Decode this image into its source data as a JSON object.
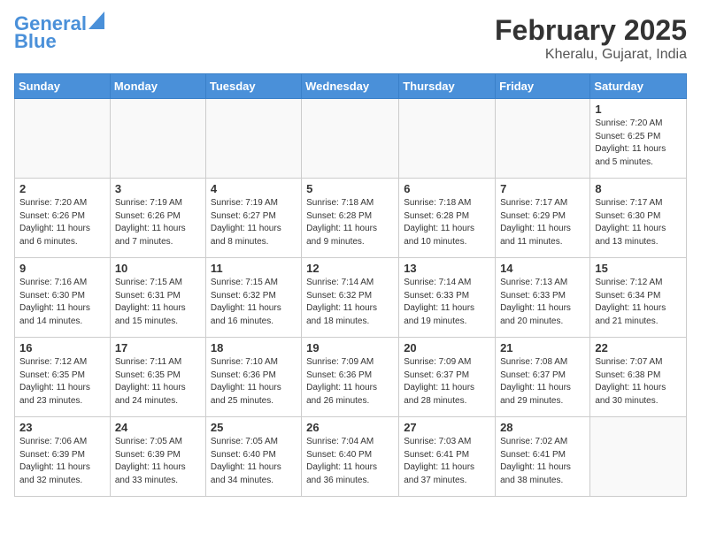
{
  "header": {
    "logo_general": "General",
    "logo_blue": "Blue",
    "month_year": "February 2025",
    "location": "Kheralu, Gujarat, India"
  },
  "days_of_week": [
    "Sunday",
    "Monday",
    "Tuesday",
    "Wednesday",
    "Thursday",
    "Friday",
    "Saturday"
  ],
  "weeks": [
    [
      {
        "day": "",
        "info": ""
      },
      {
        "day": "",
        "info": ""
      },
      {
        "day": "",
        "info": ""
      },
      {
        "day": "",
        "info": ""
      },
      {
        "day": "",
        "info": ""
      },
      {
        "day": "",
        "info": ""
      },
      {
        "day": "1",
        "info": "Sunrise: 7:20 AM\nSunset: 6:25 PM\nDaylight: 11 hours\nand 5 minutes."
      }
    ],
    [
      {
        "day": "2",
        "info": "Sunrise: 7:20 AM\nSunset: 6:26 PM\nDaylight: 11 hours\nand 6 minutes."
      },
      {
        "day": "3",
        "info": "Sunrise: 7:19 AM\nSunset: 6:26 PM\nDaylight: 11 hours\nand 7 minutes."
      },
      {
        "day": "4",
        "info": "Sunrise: 7:19 AM\nSunset: 6:27 PM\nDaylight: 11 hours\nand 8 minutes."
      },
      {
        "day": "5",
        "info": "Sunrise: 7:18 AM\nSunset: 6:28 PM\nDaylight: 11 hours\nand 9 minutes."
      },
      {
        "day": "6",
        "info": "Sunrise: 7:18 AM\nSunset: 6:28 PM\nDaylight: 11 hours\nand 10 minutes."
      },
      {
        "day": "7",
        "info": "Sunrise: 7:17 AM\nSunset: 6:29 PM\nDaylight: 11 hours\nand 11 minutes."
      },
      {
        "day": "8",
        "info": "Sunrise: 7:17 AM\nSunset: 6:30 PM\nDaylight: 11 hours\nand 13 minutes."
      }
    ],
    [
      {
        "day": "9",
        "info": "Sunrise: 7:16 AM\nSunset: 6:30 PM\nDaylight: 11 hours\nand 14 minutes."
      },
      {
        "day": "10",
        "info": "Sunrise: 7:15 AM\nSunset: 6:31 PM\nDaylight: 11 hours\nand 15 minutes."
      },
      {
        "day": "11",
        "info": "Sunrise: 7:15 AM\nSunset: 6:32 PM\nDaylight: 11 hours\nand 16 minutes."
      },
      {
        "day": "12",
        "info": "Sunrise: 7:14 AM\nSunset: 6:32 PM\nDaylight: 11 hours\nand 18 minutes."
      },
      {
        "day": "13",
        "info": "Sunrise: 7:14 AM\nSunset: 6:33 PM\nDaylight: 11 hours\nand 19 minutes."
      },
      {
        "day": "14",
        "info": "Sunrise: 7:13 AM\nSunset: 6:33 PM\nDaylight: 11 hours\nand 20 minutes."
      },
      {
        "day": "15",
        "info": "Sunrise: 7:12 AM\nSunset: 6:34 PM\nDaylight: 11 hours\nand 21 minutes."
      }
    ],
    [
      {
        "day": "16",
        "info": "Sunrise: 7:12 AM\nSunset: 6:35 PM\nDaylight: 11 hours\nand 23 minutes."
      },
      {
        "day": "17",
        "info": "Sunrise: 7:11 AM\nSunset: 6:35 PM\nDaylight: 11 hours\nand 24 minutes."
      },
      {
        "day": "18",
        "info": "Sunrise: 7:10 AM\nSunset: 6:36 PM\nDaylight: 11 hours\nand 25 minutes."
      },
      {
        "day": "19",
        "info": "Sunrise: 7:09 AM\nSunset: 6:36 PM\nDaylight: 11 hours\nand 26 minutes."
      },
      {
        "day": "20",
        "info": "Sunrise: 7:09 AM\nSunset: 6:37 PM\nDaylight: 11 hours\nand 28 minutes."
      },
      {
        "day": "21",
        "info": "Sunrise: 7:08 AM\nSunset: 6:37 PM\nDaylight: 11 hours\nand 29 minutes."
      },
      {
        "day": "22",
        "info": "Sunrise: 7:07 AM\nSunset: 6:38 PM\nDaylight: 11 hours\nand 30 minutes."
      }
    ],
    [
      {
        "day": "23",
        "info": "Sunrise: 7:06 AM\nSunset: 6:39 PM\nDaylight: 11 hours\nand 32 minutes."
      },
      {
        "day": "24",
        "info": "Sunrise: 7:05 AM\nSunset: 6:39 PM\nDaylight: 11 hours\nand 33 minutes."
      },
      {
        "day": "25",
        "info": "Sunrise: 7:05 AM\nSunset: 6:40 PM\nDaylight: 11 hours\nand 34 minutes."
      },
      {
        "day": "26",
        "info": "Sunrise: 7:04 AM\nSunset: 6:40 PM\nDaylight: 11 hours\nand 36 minutes."
      },
      {
        "day": "27",
        "info": "Sunrise: 7:03 AM\nSunset: 6:41 PM\nDaylight: 11 hours\nand 37 minutes."
      },
      {
        "day": "28",
        "info": "Sunrise: 7:02 AM\nSunset: 6:41 PM\nDaylight: 11 hours\nand 38 minutes."
      },
      {
        "day": "",
        "info": ""
      }
    ]
  ]
}
